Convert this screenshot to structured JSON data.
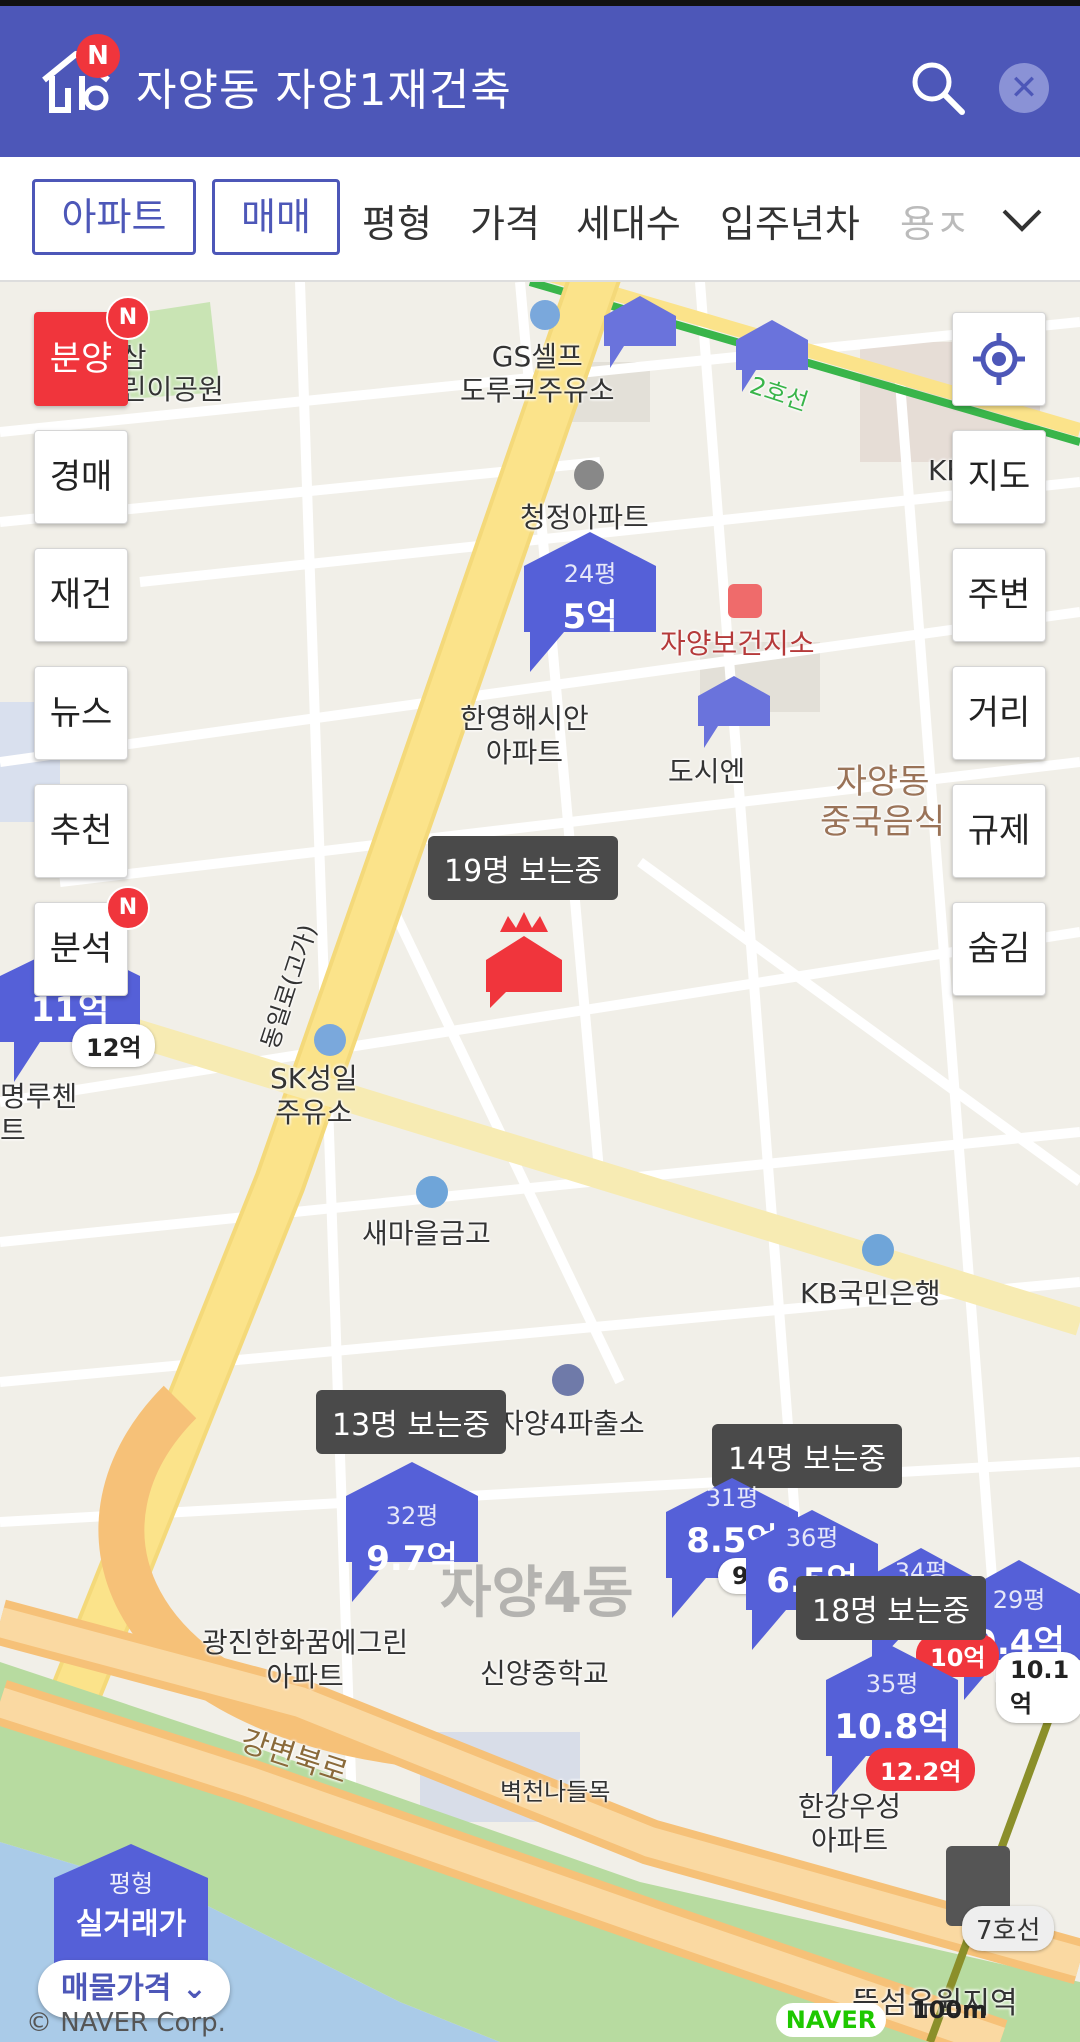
{
  "header": {
    "logo_badge": "N",
    "title": "자양동 자양1재건축"
  },
  "filters": {
    "chip_apartment": "아파트",
    "chip_sale": "매매",
    "items": [
      "평형",
      "가격",
      "세대수",
      "입주년차"
    ],
    "truncated": "용ㅈ"
  },
  "left_buttons": {
    "presale": "분양",
    "auction": "경매",
    "rebuild": "재건",
    "news": "뉴스",
    "recommend": "추천",
    "analysis": "분석",
    "badge": "N"
  },
  "right_buttons": {
    "map": "지도",
    "nearby": "주변",
    "distance": "거리",
    "regulation": "규제",
    "hide": "숨김"
  },
  "map_labels": {
    "park": "성삼\n어린이공원",
    "gas1": "GS셀프\n도루코주유소",
    "line2": "2호선",
    "kb_top": "KB",
    "apt_cheongjeong": "청정아파트",
    "health_center": "자양보건지소",
    "apt_hanyoung": "한영해시안\n아파트",
    "dosien": "도시엔",
    "jayang_chinese": "자양동\n중국음식",
    "road_main": "동일로(고가)",
    "gas2": "SK성일\n주유소",
    "left_apt": "명루첸\n트",
    "saemaeul": "새마을금고",
    "kb_bank": "KB국민은행",
    "police": "자양4파출소",
    "gwangjin_apt": "광진한화꿈에그린\n아파트",
    "school": "신양중학교",
    "district": "자양4동",
    "gangbyeon": "강변북로",
    "byeokcheon": "벽천나들목",
    "hangang_apt": "한강우성\n아파트",
    "station": "뚝섬유원지역"
  },
  "markers": [
    {
      "pyeong": "24평",
      "price": "5억"
    },
    {
      "pyeong": "32평",
      "price": "9.7억"
    },
    {
      "pyeong": "31평",
      "price": "8.5억"
    },
    {
      "pyeong": "36평",
      "price": "6.5억"
    },
    {
      "pyeong": "34평",
      "price": ""
    },
    {
      "pyeong": "29평",
      "price": "9.4억"
    },
    {
      "pyeong": "35평",
      "price": "10.8억"
    },
    {
      "pyeong": "",
      "price": "11억"
    }
  ],
  "pills": {
    "left_12": "12억",
    "red_12_2": "12.2억",
    "red_10": "10억",
    "white_10_1": "10.1억",
    "white_9": "9"
  },
  "tooltips": {
    "main": "19명 보는중",
    "t13": "13명 보는중",
    "t14": "14명 보는중",
    "t18": "18명 보는중"
  },
  "legend": {
    "pyeong": "평형",
    "real_trade": "실거래가",
    "listing_price": "매물가격"
  },
  "footer": {
    "copyright": "© NAVER Corp.",
    "naver": "NAVER",
    "scale": "100m",
    "subway_line": "7호선"
  },
  "colors": {
    "header": "#4d57b8",
    "marker": "#5560d8",
    "accent_red": "#f0353c",
    "road_yellow": "#fbe38a",
    "highway_orange": "#f6c178",
    "river": "#aacbe8",
    "park": "#b7dba0",
    "line2_green": "#39b54a"
  }
}
